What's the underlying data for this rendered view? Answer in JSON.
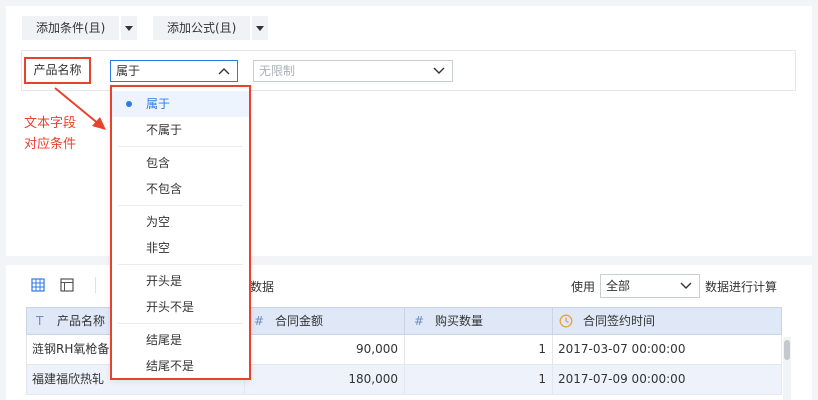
{
  "toolbar": {
    "add_condition": "添加条件(且)",
    "add_formula": "添加公式(且)"
  },
  "condition": {
    "field_label": "产品名称",
    "operator_value": "属于",
    "value_placeholder": "无限制"
  },
  "annotation": {
    "line1": "文本字段",
    "line2": "对应条件"
  },
  "dropdown": {
    "groups": [
      [
        "属于",
        "不属于"
      ],
      [
        "包含",
        "不包含"
      ],
      [
        "为空",
        "非空"
      ],
      [
        "开头是",
        "开头不是"
      ],
      [
        "结尾是",
        "结尾不是"
      ]
    ],
    "selected": "属于"
  },
  "data_panel": {
    "partial_label": "数据",
    "use_label": "使用",
    "use_select": "全部",
    "calc_label": "数据进行计算"
  },
  "table": {
    "headers": [
      {
        "icon": "T",
        "label": "产品名称"
      },
      {
        "icon": "#",
        "label": "合同金额"
      },
      {
        "icon": "#",
        "label": "购买数量"
      },
      {
        "icon": "clock",
        "label": "合同签约时间"
      }
    ],
    "rows": [
      [
        "涟钢RH氧枪备",
        "90,000",
        "1",
        "2017-03-07 00:00:00"
      ],
      [
        "福建福欣热轧",
        "180,000",
        "1",
        "2017-07-09 00:00:00"
      ]
    ]
  },
  "colors": {
    "accent": "#2c7be5",
    "highlight": "#e8422f"
  }
}
